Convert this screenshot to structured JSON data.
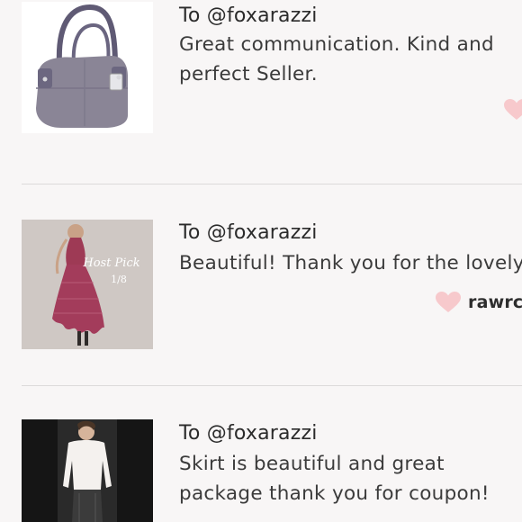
{
  "feed": {
    "entries": [
      {
        "recipient": "To @foxarazzi",
        "message": "Great communication. Kind and perfect Seller.",
        "image": "purple-leather-handbag",
        "liked_by": ""
      },
      {
        "recipient": "To @foxarazzi",
        "message": "Beautiful! Thank you for the lovely",
        "image": "red-lace-dress",
        "image_overlay_text": [
          "Host Pick",
          "1/8"
        ],
        "liked_by": "rawrch"
      },
      {
        "recipient": "To @foxarazzi",
        "message": "Skirt is beautiful and great package thank you for coupon!",
        "image": "white-blouse-leather-skirt",
        "liked_by": ""
      }
    ]
  },
  "icons": {
    "like": "heart-icon"
  },
  "colors": {
    "background": "#f8f6f6",
    "heart": "#f7c9cc",
    "divider": "#dcdada",
    "text": "#3b3b3b"
  }
}
